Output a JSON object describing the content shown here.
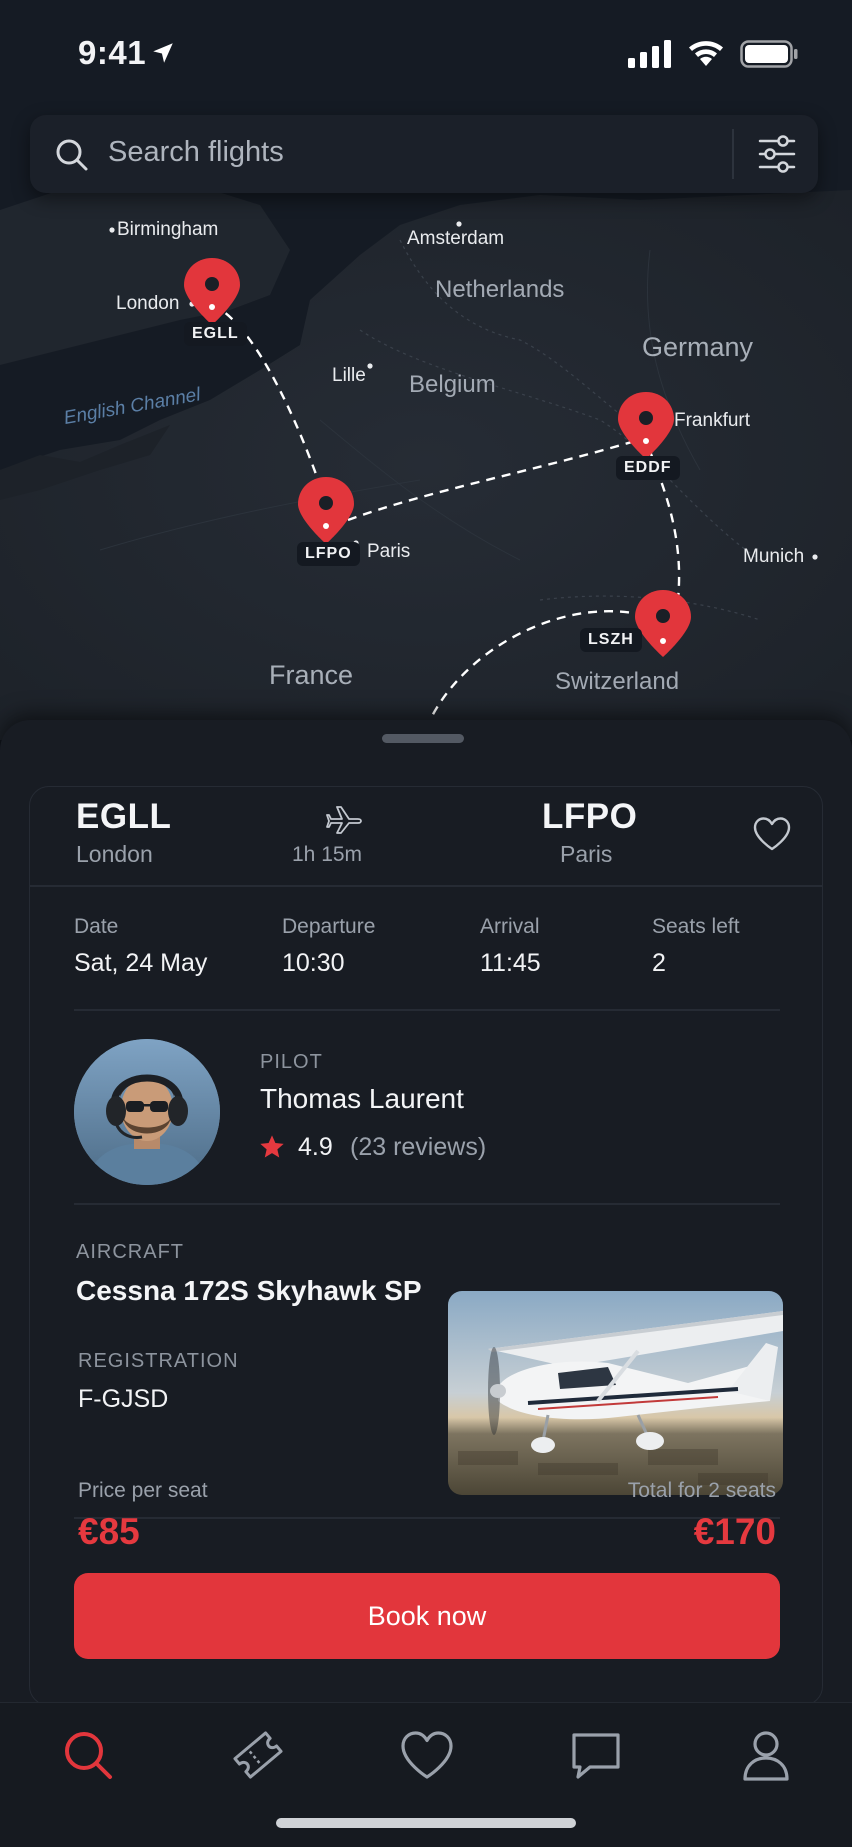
{
  "status_bar": {
    "time": "9:41"
  },
  "search": {
    "placeholder": "Search flights"
  },
  "map": {
    "cities": [
      "Birmingham",
      "London",
      "Amsterdam",
      "Lille",
      "Frankfurt",
      "Paris",
      "Munich"
    ],
    "countries": [
      "Netherlands",
      "Belgium",
      "Germany",
      "France",
      "Switzerland"
    ],
    "sea": "English Channel",
    "airports": [
      "EGLL",
      "LFPO",
      "EDDF",
      "LSZH"
    ]
  },
  "flight": {
    "origin": {
      "code": "EGLL",
      "city": "London"
    },
    "destination": {
      "code": "LFPO",
      "city": "Paris"
    },
    "duration": "1h 15m",
    "details": [
      {
        "label": "Date",
        "value": "Sat, 24 May"
      },
      {
        "label": "Departure",
        "value": "10:30"
      },
      {
        "label": "Arrival",
        "value": "11:45"
      },
      {
        "label": "Seats left",
        "value": "2"
      }
    ]
  },
  "pilot": {
    "section_label": "PILOT",
    "name": "Thomas Laurent",
    "rating": "4.9",
    "reviews": "(23 reviews)"
  },
  "aircraft": {
    "section_label": "AIRCRAFT",
    "model": "Cessna 172S Skyhawk SP",
    "registration_label": "REGISTRATION",
    "registration": "F-GJSD"
  },
  "pricing": {
    "per_seat_label": "Price per seat",
    "per_seat": "€85",
    "total_label": "Total for 2 seats",
    "total": "€170"
  },
  "cta": {
    "label": "Book now"
  },
  "tabs": [
    "search",
    "tickets",
    "favorites",
    "messages",
    "profile"
  ],
  "colors": {
    "accent": "#e2363c",
    "background": "#181c23",
    "map": "#1e242d"
  }
}
